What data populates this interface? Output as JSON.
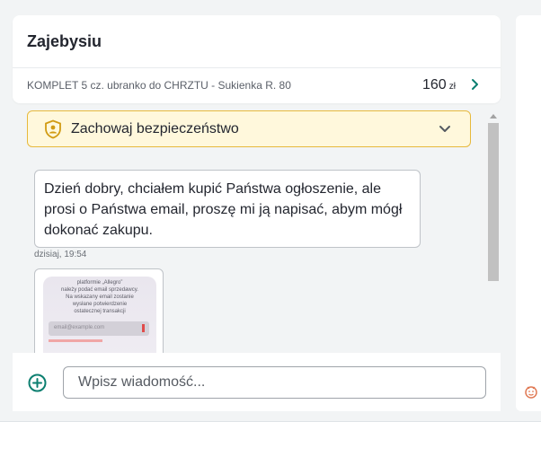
{
  "conversation": {
    "title": "Zajebysiu",
    "listing_title": "KOMPLET 5 cz. ubranko do CHRZTU - Sukienka R. 80",
    "price_value": "160",
    "price_currency": "zł"
  },
  "safety_banner": {
    "label": "Zachowaj bezpieczeństwo"
  },
  "messages": [
    {
      "text": "Dzień dobry, chciałem kupić Państwa ogłoszenie, ale prosi o Państwa email, proszę mi ją napisać, abym mógł dokonać zakupu.",
      "time": "dzisiaj, 19:54"
    }
  ],
  "attachment_preview": {
    "lines": [
      "platformie „Allegro”",
      "należy podać email sprzedawcy.",
      "Na wskazany email zostanie",
      "wysłane potwierdzenie",
      "ostatecznej transakcji"
    ],
    "field_placeholder": "email@example.com"
  },
  "composer": {
    "placeholder": "Wpisz wiadomość..."
  },
  "colors": {
    "accent": "#0b7f70",
    "banner_bg": "#fff8dc",
    "banner_border": "#e7b93c"
  },
  "icons": {
    "send_attachment": "plus-circle-icon",
    "safety": "shield-person-icon",
    "expand": "chevron-down-icon",
    "open_listing": "chevron-right-icon"
  }
}
